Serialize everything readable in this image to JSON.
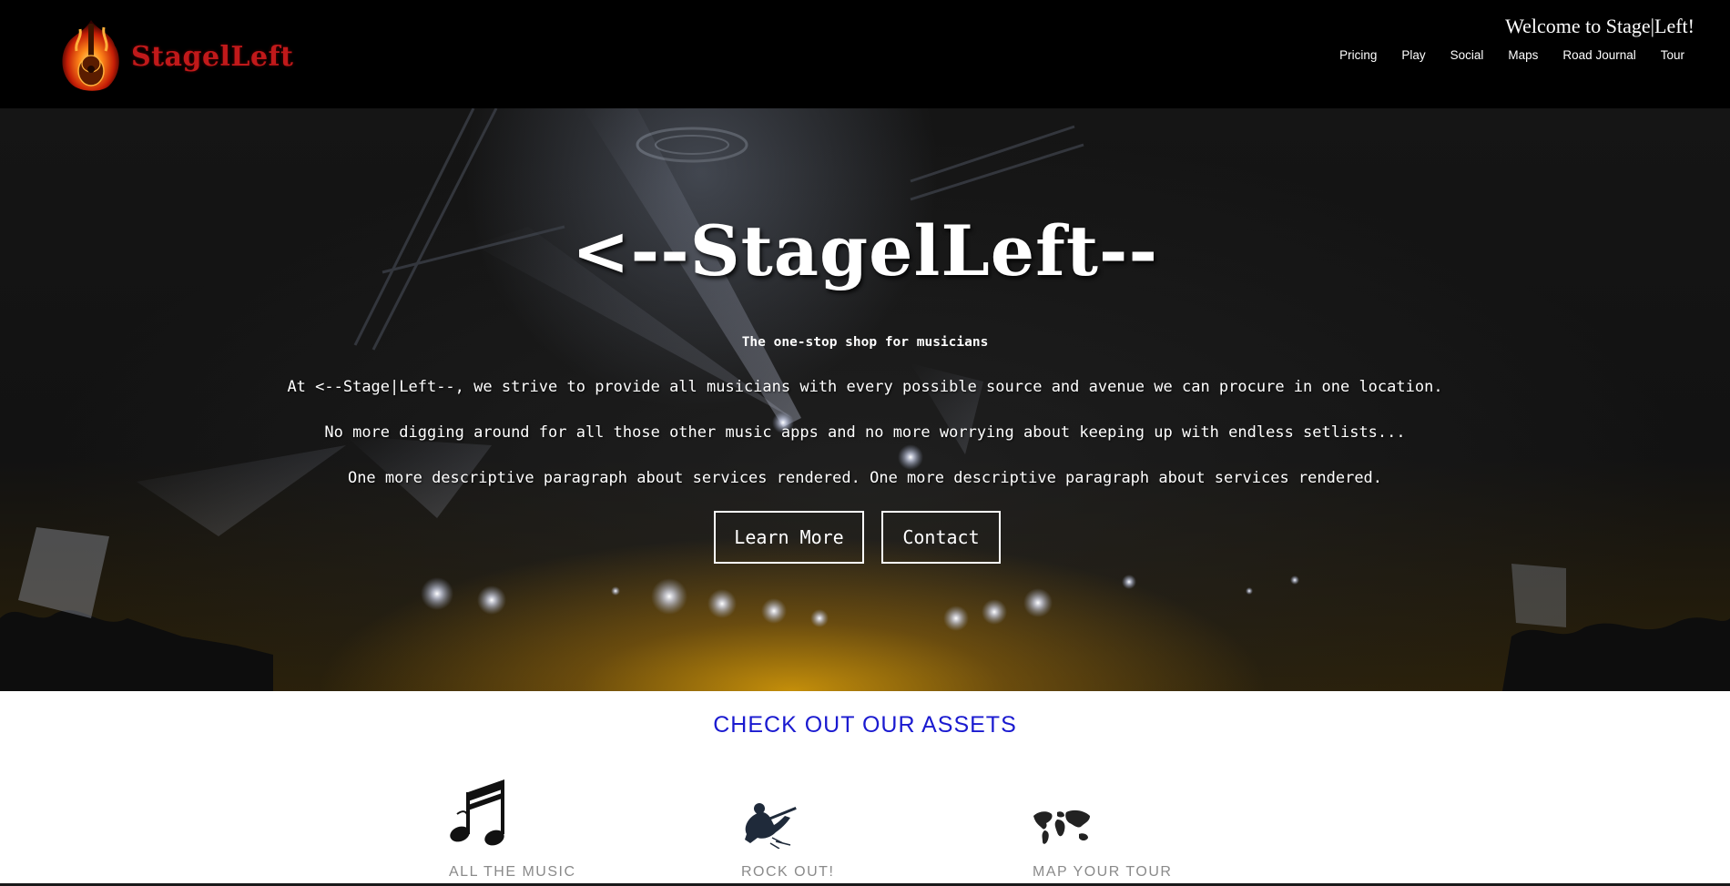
{
  "header": {
    "logo_text": "StagelLeft",
    "welcome": "Welcome to Stage|Left!",
    "nav": [
      "Pricing",
      "Play",
      "Social",
      "Maps",
      "Road Journal",
      "Tour"
    ]
  },
  "hero": {
    "title": "<--StagelLeft--",
    "subtitle": "The one-stop shop for musicians",
    "paragraphs": [
      "At <--Stage|Left--, we strive to provide all musicians with every possible source and avenue we can procure in one location.",
      "No more digging around for all those other music apps and no more worrying about keeping up with endless setlists...",
      "One more descriptive paragraph about services rendered. One more descriptive paragraph about services rendered."
    ],
    "buttons": {
      "learn_more": "Learn More",
      "contact": "Contact"
    }
  },
  "assets": {
    "title": "CHECK OUT OUR ASSETS",
    "items": [
      {
        "label": "ALL THE MUSIC",
        "icon": "music-notes-icon"
      },
      {
        "label": "ROCK OUT!",
        "icon": "guitarist-icon"
      },
      {
        "label": "MAP YOUR TOUR",
        "icon": "world-map-icon"
      }
    ]
  },
  "colors": {
    "header_bg": "#000000",
    "logo_red": "#c0191a",
    "assets_title_blue": "#1a1ad0",
    "asset_label_gray": "#8a8a8a"
  }
}
